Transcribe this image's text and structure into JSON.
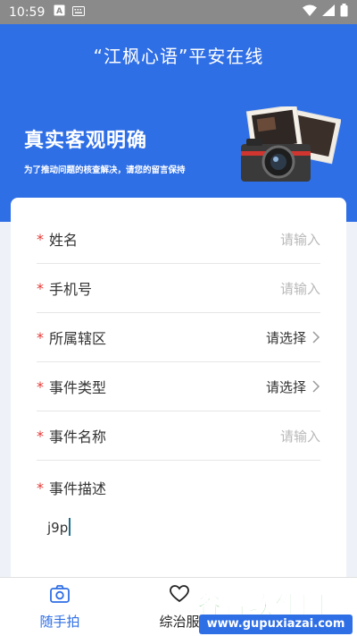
{
  "status_bar": {
    "time": "10:59"
  },
  "header": {
    "title": "“江枫心语”平安在线",
    "banner_title": "真实客观明确",
    "banner_subtitle": "为了推动问题的核查解决，请您的留言保持"
  },
  "form": {
    "required_mark": "*",
    "fields": [
      {
        "label": "姓名",
        "value": "请输入",
        "kind": "input"
      },
      {
        "label": "手机号",
        "value": "请输入",
        "kind": "input"
      },
      {
        "label": "所属辖区",
        "value": "请选择",
        "kind": "select"
      },
      {
        "label": "事件类型",
        "value": "请选择",
        "kind": "select"
      },
      {
        "label": "事件名称",
        "value": "请输入",
        "kind": "input"
      }
    ],
    "description": {
      "label": "事件描述",
      "value": "j9p"
    }
  },
  "bottom_nav": {
    "items": [
      {
        "label": "随手拍",
        "icon": "camera-icon",
        "active": true
      },
      {
        "label": "综治服",
        "icon": "heart-icon",
        "active": false
      }
    ]
  },
  "watermark": {
    "brand": "谷普软件园",
    "url": "www.gupuxiazai.com"
  },
  "colors": {
    "primary": "#2f6fe6",
    "required": "#e53935",
    "placeholder": "#b9b9b9"
  }
}
